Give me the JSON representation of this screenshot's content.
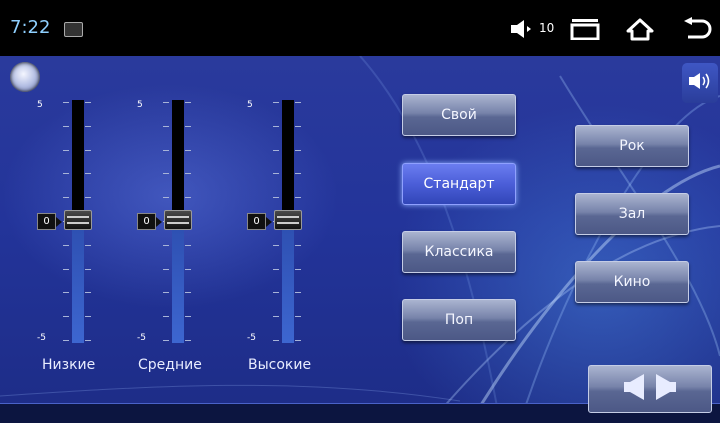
{
  "status_bar": {
    "time": "7:22",
    "volume_level": "10",
    "icons": [
      "gallery-icon",
      "volume-icon",
      "recent-apps-icon",
      "home-icon",
      "back-icon"
    ]
  },
  "sliders": [
    {
      "label": "Низкие",
      "max_label": "5",
      "min_label": "-5",
      "value": 0
    },
    {
      "label": "Средние",
      "max_label": "5",
      "min_label": "-5",
      "value": 0
    },
    {
      "label": "Высокие",
      "max_label": "5",
      "min_label": "-5",
      "value": 0
    }
  ],
  "presets": {
    "custom": "Свой",
    "standard": "Стандарт",
    "classic": "Классика",
    "pop": "Поп",
    "rock": "Рок",
    "hall": "Зал",
    "cinema": "Кино",
    "selected": "standard"
  },
  "colors": {
    "accent": "#4b5ed8",
    "background": "#23349a",
    "clock": "#8fd0ff"
  }
}
